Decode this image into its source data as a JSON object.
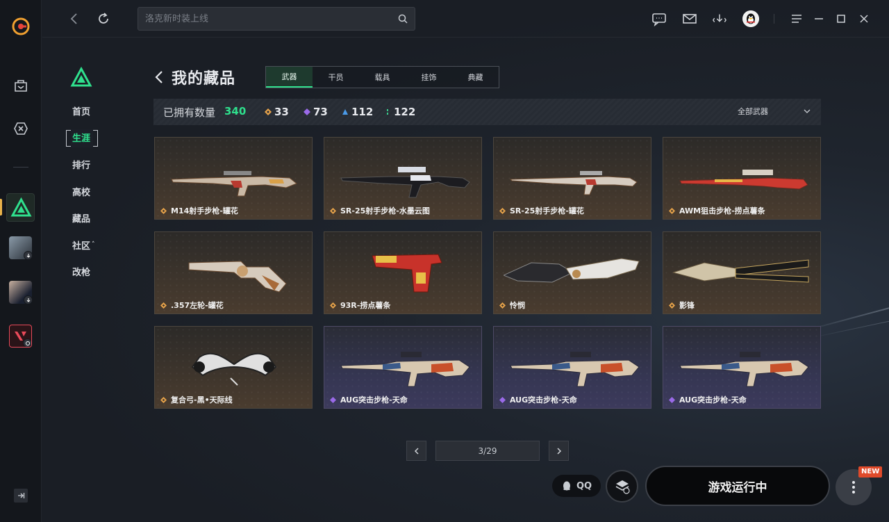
{
  "search": {
    "placeholder": "洛克新时装上线"
  },
  "sub_nav": [
    {
      "label": "首页"
    },
    {
      "label": "生涯",
      "active": true
    },
    {
      "label": "排行"
    },
    {
      "label": "高校"
    },
    {
      "label": "藏品"
    },
    {
      "label": "社区",
      "caret": "˄"
    },
    {
      "label": "改枪"
    }
  ],
  "page": {
    "title": "我的藏品"
  },
  "tabs": [
    {
      "label": "武器",
      "active": true
    },
    {
      "label": "干员"
    },
    {
      "label": "载具"
    },
    {
      "label": "挂饰"
    },
    {
      "label": "典藏"
    }
  ],
  "stats": {
    "owned_label": "已拥有数量",
    "owned_count": "340",
    "rarities": [
      {
        "color": "#e8a34a",
        "count": "33"
      },
      {
        "color": "#9a6ae8",
        "count": "73"
      },
      {
        "color": "#4a9ae8",
        "count": "112"
      },
      {
        "color": "#3ac88a",
        "count": "122"
      }
    ],
    "filter_label": "全部武器"
  },
  "items": [
    {
      "name": "M14射手步枪-罐花",
      "rarity": "gold",
      "kind": "rifle"
    },
    {
      "name": "SR-25射手步枪-水墨云图",
      "rarity": "gold",
      "kind": "rifle-dark"
    },
    {
      "name": "SR-25射手步枪-罐花",
      "rarity": "gold",
      "kind": "rifle-long"
    },
    {
      "name": "AWM狙击步枪-捞点薯条",
      "rarity": "gold",
      "kind": "sniper"
    },
    {
      "name": ".357左轮-罐花",
      "rarity": "gold",
      "kind": "revolver"
    },
    {
      "name": "93R-捞点薯条",
      "rarity": "gold",
      "kind": "pistol"
    },
    {
      "name": "怜悯",
      "rarity": "gold",
      "kind": "knife"
    },
    {
      "name": "影锋",
      "rarity": "gold",
      "kind": "blade"
    },
    {
      "name": "复合弓-黑•天际线",
      "rarity": "gold",
      "kind": "bow"
    },
    {
      "name": "AUG突击步枪-天命",
      "rarity": "purple",
      "kind": "aug"
    },
    {
      "name": "AUG突击步枪-天命",
      "rarity": "purple",
      "kind": "aug"
    },
    {
      "name": "AUG突击步枪-天命",
      "rarity": "purple",
      "kind": "aug"
    }
  ],
  "pager": {
    "label": "3/29"
  },
  "bottom": {
    "qq_label": "QQ",
    "run_label": "游戏运行中",
    "new_badge": "NEW"
  }
}
